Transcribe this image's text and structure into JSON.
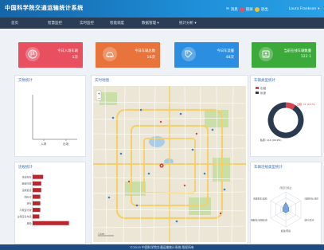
{
  "header": {
    "title": "中国科学院交通运输统计系统",
    "user": {
      "msg_label": "消息",
      "lock_label": "锁屏",
      "user_label": "退出",
      "username": "Laura Frankson"
    }
  },
  "nav": {
    "items": [
      "首页",
      "智慧监控",
      "实时监控",
      "智能调度",
      "数据管理 ▾",
      "统计分析 ▾"
    ]
  },
  "cards": [
    {
      "label": "今日入场车辆",
      "value": "5次",
      "color": "#e84f5f",
      "icon": "flag-icon"
    },
    {
      "label": "今日车辆总数",
      "value": "16次",
      "color": "#e8743b",
      "icon": "car-icon"
    },
    {
      "label": "今日车流量",
      "value": "48次",
      "color": "#2b8ee0",
      "icon": "tag-icon"
    },
    {
      "label": "当前在线车辆数量",
      "value": "122 1",
      "color": "#3caa3a",
      "icon": "user-icon"
    }
  ],
  "panels": {
    "left_top": {
      "title": "交易统计",
      "x_labels": [
        "入场",
        "出场"
      ]
    },
    "map": {
      "title": "实时地图",
      "scale": "1 km"
    },
    "right_top": {
      "title": "车辆类型统计",
      "legend": [
        "出租",
        "私家"
      ],
      "slice_labels": [
        "出租: 11 (9.1%)",
        "私家: 110 (90.9%)"
      ]
    },
    "left_bottom": {
      "title": "违规统计"
    },
    "right_bottom": {
      "title": "车辆违规类型统计",
      "axes": [
        "闯红灯/禁止",
        "违规掉头/违停",
        "逆行/禁行",
        "超速/限速",
        "违规超车/违规变道",
        "违规乘车/其他"
      ]
    }
  },
  "chart_data": [
    {
      "type": "bar",
      "title": "交易统计",
      "categories": [
        "入场",
        "出场"
      ],
      "values": [
        0,
        0
      ]
    },
    {
      "type": "pie",
      "title": "车辆类型统计",
      "labels": [
        "出租",
        "私家"
      ],
      "values": [
        11,
        110
      ],
      "colors": [
        "#d9434f",
        "#2b3a4e"
      ]
    },
    {
      "type": "bar",
      "title": "违规统计",
      "orientation": "horizontal",
      "categories": [
        "违法停车",
        "超速行驶",
        "违规变道",
        "闯红灯",
        "逆行",
        "不按道行驶",
        "占用应急车道",
        "其他"
      ],
      "values": [
        11,
        9,
        9,
        8,
        8,
        8,
        7,
        38
      ],
      "xlim": [
        0,
        50
      ],
      "color": "#b8282e"
    },
    {
      "type": "radar",
      "title": "车辆违规类型统计",
      "axes": [
        "闯红灯/禁止",
        "违规掉头/违停",
        "逆行/禁行",
        "超速/限速",
        "违规超车/违规变道",
        "违规乘车/其他"
      ],
      "values": [
        4,
        2,
        2,
        2,
        2,
        2
      ],
      "max": 10
    }
  ],
  "footer": {
    "text": "©2019 中国科学院交通运输统计系统 版权所有"
  }
}
